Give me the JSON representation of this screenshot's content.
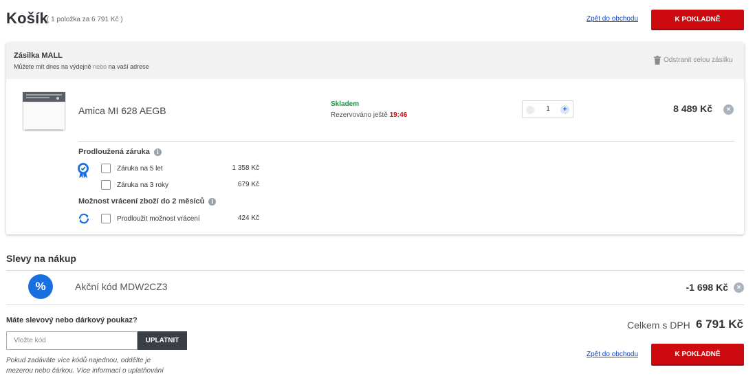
{
  "header": {
    "title": "Košík",
    "summary": "( 1 položka za 6 791 Kč )",
    "back_link": "Zpět do obchodu",
    "checkout_button": "K POKLADNĚ"
  },
  "shipment": {
    "title": "Zásilka MALL",
    "subtitle_prefix": "Můžete mít dnes na výdejně",
    "subtitle_or": "nebo",
    "subtitle_suffix": "na vaší adrese",
    "remove_all": "Odstranit celou zásilku",
    "product": {
      "name": "Amica MI 628 AEGB",
      "stock": "Skladem",
      "reserved_label": "Rezervováno ještě",
      "reserved_time": "19:46",
      "quantity": "1",
      "price": "8 489 Kč"
    },
    "warranty": {
      "title": "Prodloužená záruka",
      "options": [
        {
          "label": "Záruka na 5 let",
          "price": "1 358 Kč"
        },
        {
          "label": "Záruka na 3 roky",
          "price": "679 Kč"
        }
      ]
    },
    "return": {
      "title": "Možnost vrácení zboží do 2 měsíců",
      "option": {
        "label": "Prodloužit možnost vrácení",
        "price": "424 Kč"
      }
    }
  },
  "discounts": {
    "title": "Slevy na nákup",
    "icon_symbol": "%",
    "code_label": "Akční kód MDW2CZ3",
    "amount": "-1 698 Kč"
  },
  "voucher": {
    "question": "Máte slevový nebo dárkový poukaz?",
    "input_placeholder": "Vložte kód",
    "apply_button": "UPLATNIT",
    "hint_line1": "Pokud zadáváte více kódů najednou, oddělte je",
    "hint_line2": "mezerou nebo čárkou. Více informací o uplatňování"
  },
  "total": {
    "label": "Celkem s DPH",
    "value": "6 791 Kč"
  },
  "footer": {
    "back_link": "Zpět do obchodu",
    "checkout_button": "K POKLADNĚ"
  },
  "colors": {
    "accent_red": "#cc0a0f",
    "link_blue": "#0a46d6",
    "stock_green": "#1a9641",
    "discount_blue": "#1a6fe0"
  },
  "icons": {
    "remove_all": "trash-icon",
    "remove_item": "close-icon",
    "info": "info-icon",
    "warranty": "warranty-badge-icon",
    "return": "refresh-icon",
    "discount": "percent-icon"
  }
}
